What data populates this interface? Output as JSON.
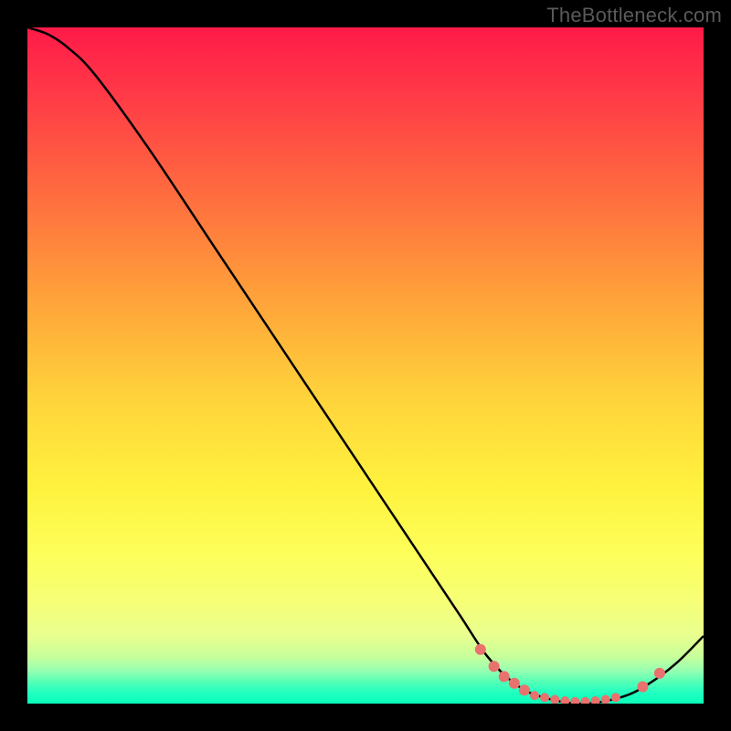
{
  "watermark": "TheBottleneck.com",
  "chart_data": {
    "type": "line",
    "title": "",
    "xlabel": "",
    "ylabel": "",
    "xlim": [
      0,
      100
    ],
    "ylim": [
      0,
      100
    ],
    "grid": false,
    "curve_points": [
      {
        "x": 0,
        "y": 100
      },
      {
        "x": 3,
        "y": 99
      },
      {
        "x": 6,
        "y": 97
      },
      {
        "x": 10,
        "y": 93
      },
      {
        "x": 18,
        "y": 82
      },
      {
        "x": 28,
        "y": 67
      },
      {
        "x": 40,
        "y": 49
      },
      {
        "x": 50,
        "y": 34
      },
      {
        "x": 58,
        "y": 22
      },
      {
        "x": 64,
        "y": 13
      },
      {
        "x": 68,
        "y": 7
      },
      {
        "x": 72,
        "y": 3
      },
      {
        "x": 76,
        "y": 1
      },
      {
        "x": 82,
        "y": 0
      },
      {
        "x": 88,
        "y": 1
      },
      {
        "x": 92,
        "y": 3
      },
      {
        "x": 96,
        "y": 6
      },
      {
        "x": 100,
        "y": 10
      }
    ],
    "markers_left": [
      {
        "x": 67,
        "y": 8
      },
      {
        "x": 69,
        "y": 5.5
      },
      {
        "x": 70.5,
        "y": 4
      },
      {
        "x": 72,
        "y": 3
      },
      {
        "x": 73.5,
        "y": 2
      }
    ],
    "markers_bottom": [
      {
        "x": 75,
        "y": 1.2
      },
      {
        "x": 76.5,
        "y": 0.9
      },
      {
        "x": 78,
        "y": 0.6
      },
      {
        "x": 79.5,
        "y": 0.4
      },
      {
        "x": 81,
        "y": 0.3
      },
      {
        "x": 82.5,
        "y": 0.3
      },
      {
        "x": 84,
        "y": 0.4
      },
      {
        "x": 85.5,
        "y": 0.6
      },
      {
        "x": 87,
        "y": 0.9
      }
    ],
    "markers_right": [
      {
        "x": 91,
        "y": 2.5
      },
      {
        "x": 93.5,
        "y": 4.5
      }
    ],
    "gradient_stops": [
      {
        "pos": 0,
        "color": "#ff1a48"
      },
      {
        "pos": 0.55,
        "color": "#ffd43b"
      },
      {
        "pos": 0.85,
        "color": "#f6ff77"
      },
      {
        "pos": 1.0,
        "color": "#0affba"
      }
    ]
  }
}
